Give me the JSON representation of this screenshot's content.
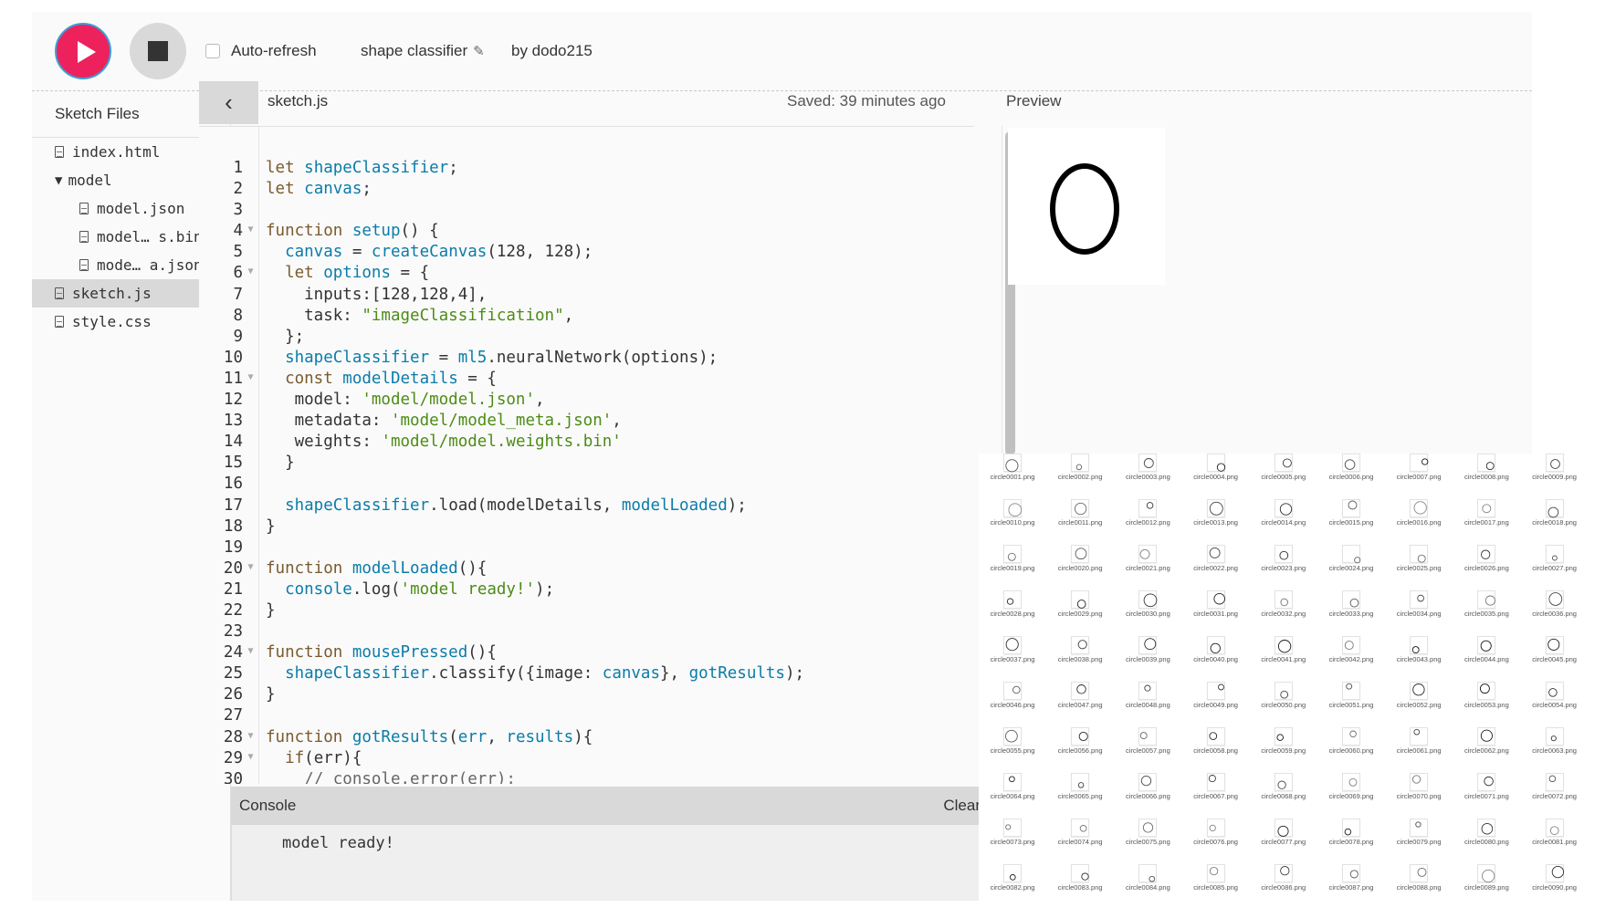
{
  "toolbar": {
    "play_label": "Play",
    "stop_label": "Stop",
    "auto_refresh_label": "Auto-refresh",
    "auto_refresh_checked": false,
    "sketch_name": "shape classifier",
    "author": "by dodo215",
    "accent_color": "#ed225d"
  },
  "sidebar": {
    "title": "Sketch Files",
    "files": [
      {
        "name": "index.html",
        "type": "file",
        "indent": false,
        "selected": false
      },
      {
        "name": "model",
        "type": "folder",
        "indent": false,
        "selected": false
      },
      {
        "name": "model.json",
        "type": "file",
        "indent": true,
        "selected": false
      },
      {
        "name": "model… s.bin",
        "type": "file",
        "indent": true,
        "selected": false
      },
      {
        "name": "mode… a.json",
        "type": "file",
        "indent": true,
        "selected": false
      },
      {
        "name": "sketch.js",
        "type": "file",
        "indent": false,
        "selected": true
      },
      {
        "name": "style.css",
        "type": "file",
        "indent": false,
        "selected": false
      }
    ]
  },
  "editor": {
    "collapse_icon": "‹",
    "file_name": "sketch.js",
    "saved_status": "Saved: 39 minutes ago",
    "lines": [
      {
        "n": "1",
        "fold": false,
        "tokens": [
          [
            "kw",
            "let "
          ],
          [
            "var",
            "shapeClassifier"
          ],
          [
            "",
            "; "
          ]
        ]
      },
      {
        "n": "2",
        "fold": false,
        "tokens": [
          [
            "kw",
            "let "
          ],
          [
            "var",
            "canvas"
          ],
          [
            "",
            ";"
          ]
        ]
      },
      {
        "n": "3",
        "fold": false,
        "tokens": []
      },
      {
        "n": "4",
        "fold": true,
        "tokens": [
          [
            "kw",
            "function "
          ],
          [
            "var",
            "setup"
          ],
          [
            "",
            "() {"
          ]
        ]
      },
      {
        "n": "5",
        "fold": false,
        "tokens": [
          [
            "",
            "  "
          ],
          [
            "var",
            "canvas"
          ],
          [
            "",
            " = "
          ],
          [
            "var",
            "createCanvas"
          ],
          [
            "",
            "(128, 128);"
          ]
        ]
      },
      {
        "n": "6",
        "fold": true,
        "tokens": [
          [
            "",
            "  "
          ],
          [
            "kw",
            "let "
          ],
          [
            "var",
            "options"
          ],
          [
            "",
            " = {"
          ]
        ]
      },
      {
        "n": "7",
        "fold": false,
        "tokens": [
          [
            "",
            "    inputs:[128,128,4],"
          ]
        ]
      },
      {
        "n": "8",
        "fold": false,
        "tokens": [
          [
            "",
            "    task: "
          ],
          [
            "str",
            "\"imageClassification\""
          ],
          [
            "",
            ","
          ]
        ]
      },
      {
        "n": "9",
        "fold": false,
        "tokens": [
          [
            "",
            "  };"
          ]
        ]
      },
      {
        "n": "10",
        "fold": false,
        "tokens": [
          [
            "",
            "  "
          ],
          [
            "var",
            "shapeClassifier"
          ],
          [
            "",
            " = "
          ],
          [
            "var",
            "ml5"
          ],
          [
            "",
            ".neuralNetwork(options);"
          ]
        ]
      },
      {
        "n": "11",
        "fold": true,
        "tokens": [
          [
            "",
            "  "
          ],
          [
            "kw",
            "const "
          ],
          [
            "var",
            "modelDetails"
          ],
          [
            "",
            " = {"
          ]
        ]
      },
      {
        "n": "12",
        "fold": false,
        "tokens": [
          [
            "",
            "   model: "
          ],
          [
            "str",
            "'model/model.json'"
          ],
          [
            "",
            ","
          ]
        ]
      },
      {
        "n": "13",
        "fold": false,
        "tokens": [
          [
            "",
            "   metadata: "
          ],
          [
            "str",
            "'model/model_meta.json'"
          ],
          [
            "",
            ","
          ]
        ]
      },
      {
        "n": "14",
        "fold": false,
        "tokens": [
          [
            "",
            "   weights: "
          ],
          [
            "str",
            "'model/model.weights.bin'"
          ]
        ]
      },
      {
        "n": "15",
        "fold": false,
        "tokens": [
          [
            "",
            "  }"
          ]
        ]
      },
      {
        "n": "16",
        "fold": false,
        "tokens": []
      },
      {
        "n": "17",
        "fold": false,
        "tokens": [
          [
            "",
            "  "
          ],
          [
            "var",
            "shapeClassifier"
          ],
          [
            "",
            ".load(modelDetails, "
          ],
          [
            "var",
            "modelLoaded"
          ],
          [
            "",
            ");"
          ]
        ]
      },
      {
        "n": "18",
        "fold": false,
        "tokens": [
          [
            "",
            "}"
          ]
        ]
      },
      {
        "n": "19",
        "fold": false,
        "tokens": []
      },
      {
        "n": "20",
        "fold": true,
        "tokens": [
          [
            "kw",
            "function "
          ],
          [
            "var",
            "modelLoaded"
          ],
          [
            "",
            "(){"
          ]
        ]
      },
      {
        "n": "21",
        "fold": false,
        "tokens": [
          [
            "",
            "  "
          ],
          [
            "var",
            "console"
          ],
          [
            "",
            ".log("
          ],
          [
            "str",
            "'model ready!'"
          ],
          [
            "",
            ");"
          ]
        ]
      },
      {
        "n": "22",
        "fold": false,
        "tokens": [
          [
            "",
            "}"
          ]
        ]
      },
      {
        "n": "23",
        "fold": false,
        "tokens": []
      },
      {
        "n": "24",
        "fold": true,
        "tokens": [
          [
            "kw",
            "function "
          ],
          [
            "var",
            "mousePressed"
          ],
          [
            "",
            "(){"
          ]
        ]
      },
      {
        "n": "25",
        "fold": false,
        "tokens": [
          [
            "",
            "  "
          ],
          [
            "var",
            "shapeClassifier"
          ],
          [
            "",
            ".classify({image: "
          ],
          [
            "var",
            "canvas"
          ],
          [
            "",
            "}, "
          ],
          [
            "var",
            "gotResults"
          ],
          [
            "",
            ");"
          ]
        ]
      },
      {
        "n": "26",
        "fold": false,
        "tokens": [
          [
            "",
            "}"
          ]
        ]
      },
      {
        "n": "27",
        "fold": false,
        "tokens": []
      },
      {
        "n": "28",
        "fold": true,
        "tokens": [
          [
            "kw",
            "function "
          ],
          [
            "var",
            "gotResults"
          ],
          [
            "",
            "("
          ],
          [
            "var",
            "err"
          ],
          [
            "",
            ", "
          ],
          [
            "var",
            "results"
          ],
          [
            "",
            "){"
          ]
        ]
      },
      {
        "n": "29",
        "fold": true,
        "tokens": [
          [
            "",
            "  "
          ],
          [
            "kw",
            "if"
          ],
          [
            "",
            "(err){"
          ]
        ]
      },
      {
        "n": "30",
        "fold": false,
        "tokens": [
          [
            "",
            "    "
          ],
          [
            "cmt",
            "// console.error(err);"
          ]
        ]
      }
    ]
  },
  "preview": {
    "label": "Preview",
    "shape": "circle"
  },
  "console": {
    "title": "Console",
    "clear_label": "Clear",
    "messages": [
      "model ready!"
    ]
  },
  "file_grid": {
    "columns": 9,
    "files": [
      "circle0001.png",
      "circle0002.png",
      "circle0003.png",
      "circle0004.png",
      "circle0005.png",
      "circle0006.png",
      "circle0007.png",
      "circle0008.png",
      "circle0009.png",
      "circle0010.png",
      "circle0011.png",
      "circle0012.png",
      "circle0013.png",
      "circle0014.png",
      "circle0015.png",
      "circle0016.png",
      "circle0017.png",
      "circle0018.png",
      "circle0019.png",
      "circle0020.png",
      "circle0021.png",
      "circle0022.png",
      "circle0023.png",
      "circle0024.png",
      "circle0025.png",
      "circle0026.png",
      "circle0027.png",
      "circle0028.png",
      "circle0029.png",
      "circle0030.png",
      "circle0031.png",
      "circle0032.png",
      "circle0033.png",
      "circle0034.png",
      "circle0035.png",
      "circle0036.png",
      "circle0037.png",
      "circle0038.png",
      "circle0039.png",
      "circle0040.png",
      "circle0041.png",
      "circle0042.png",
      "circle0043.png",
      "circle0044.png",
      "circle0045.png",
      "circle0046.png",
      "circle0047.png",
      "circle0048.png",
      "circle0049.png",
      "circle0050.png",
      "circle0051.png",
      "circle0052.png",
      "circle0053.png",
      "circle0054.png",
      "circle0055.png",
      "circle0056.png",
      "circle0057.png",
      "circle0058.png",
      "circle0059.png",
      "circle0060.png",
      "circle0061.png",
      "circle0062.png",
      "circle0063.png",
      "circle0064.png",
      "circle0065.png",
      "circle0066.png",
      "circle0067.png",
      "circle0068.png",
      "circle0069.png",
      "circle0070.png",
      "circle0071.png",
      "circle0072.png",
      "circle0073.png",
      "circle0074.png",
      "circle0075.png",
      "circle0076.png",
      "circle0077.png",
      "circle0078.png",
      "circle0079.png",
      "circle0080.png",
      "circle0081.png",
      "circle0082.png",
      "circle0083.png",
      "circle0084.png",
      "circle0085.png",
      "circle0086.png",
      "circle0087.png",
      "circle0088.png",
      "circle0089.png",
      "circle0090.png"
    ]
  }
}
